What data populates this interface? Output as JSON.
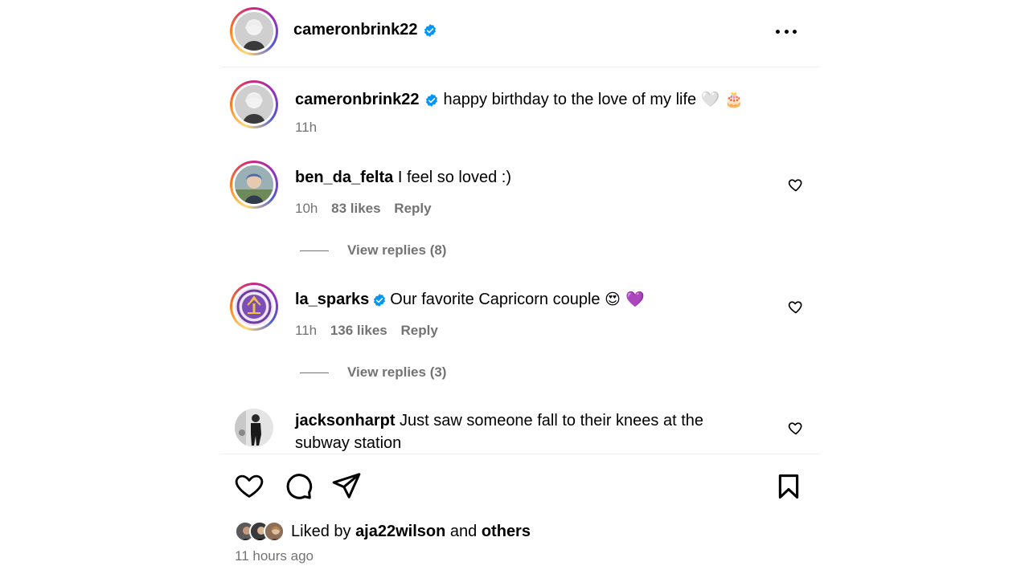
{
  "header": {
    "username": "cameronbrink22",
    "more_icon": "ellipsis-icon"
  },
  "caption": {
    "username": "cameronbrink22",
    "text": "happy birthday to the love of my life",
    "emojis": "🤍 🎂",
    "time": "11h"
  },
  "comments": [
    {
      "username": "ben_da_felta",
      "verified": false,
      "text": "I feel so loved :)",
      "time": "10h",
      "likes": "83 likes",
      "reply": "Reply",
      "view_replies": "View replies (8)"
    },
    {
      "username": "la_sparks",
      "verified": true,
      "text": "Our favorite Capricorn couple",
      "emojis": "😍 💜",
      "time": "11h",
      "likes": "136 likes",
      "reply": "Reply",
      "view_replies": "View replies (3)"
    },
    {
      "username": "jacksonharpt",
      "verified": false,
      "text": "Just saw someone fall to their knees at the",
      "text_line2": "subway station"
    }
  ],
  "footer": {
    "liked_by_prefix": "Liked by",
    "liked_by_user": "aja22wilson",
    "liked_by_and": "and",
    "liked_by_others": "others",
    "time_ago": "11 hours ago"
  },
  "colors": {
    "verified": "#0095f6",
    "muted": "#737373",
    "divider": "#efefef"
  }
}
